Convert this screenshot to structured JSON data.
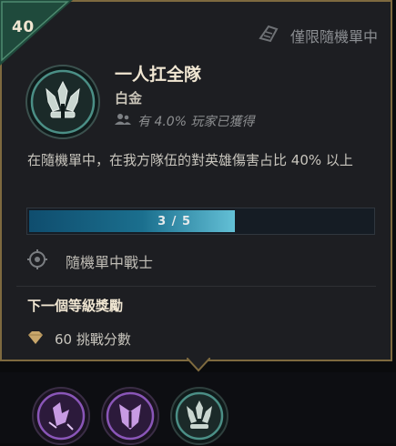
{
  "tooltip": {
    "level": "40",
    "ranked_only_label": "僅限隨機單中",
    "title": "一人扛全隊",
    "tier": "白金",
    "owned_text": "有 4.0% 玩家已獲得",
    "description": "在隨機單中，在我方隊伍的對英雄傷害占比 40% 以上",
    "progress": {
      "text": "3 / 5",
      "current": 3,
      "total": 5
    },
    "objective_label": "隨機單中戰士",
    "next_tier_title": "下一個等級獎勵",
    "reward_label": "60 挑戰分數"
  },
  "colors": {
    "gold_border": "#7e6a3f",
    "level_corner": "#1f4a3c",
    "progress_fill": "#1b6f8e",
    "platinum": "#4b8f86"
  },
  "icons": {
    "ranked": "ranked-crystal-icon",
    "crest": "platinum-crown-crest-icon",
    "players": "players-icon",
    "objective": "position-target-icon",
    "reward": "challenge-point-gem-icon"
  },
  "bottom_icons": [
    "purple-fist-icon",
    "purple-shield-icon",
    "platinum-crown-icon"
  ]
}
